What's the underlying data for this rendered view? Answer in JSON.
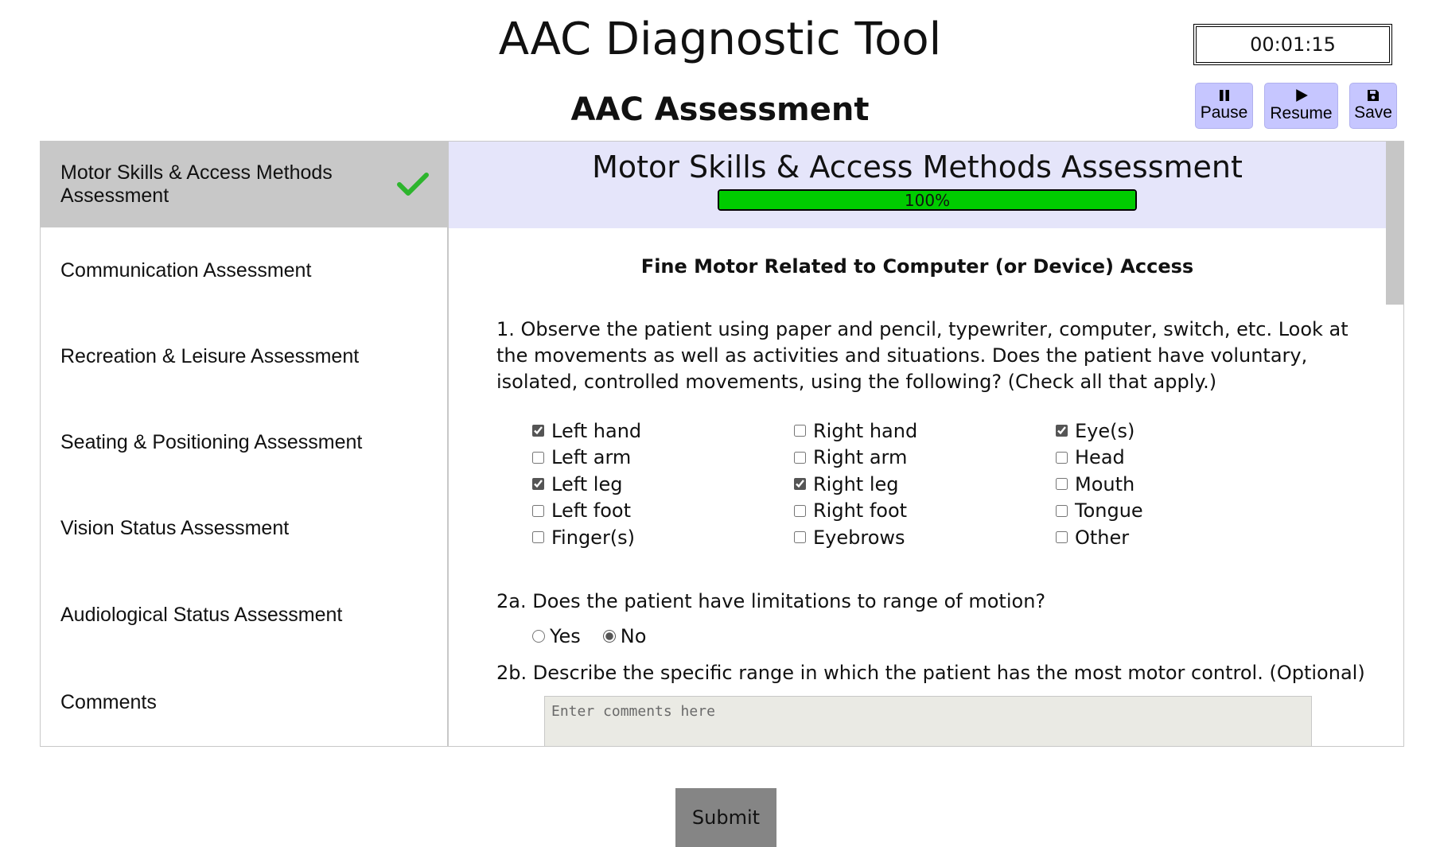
{
  "app": {
    "title": "AAC Diagnostic Tool",
    "subtitle": "AAC Assessment"
  },
  "timer": "00:01:15",
  "controls": {
    "pause": "Pause",
    "resume": "Resume",
    "save": "Save"
  },
  "sidebar": {
    "items": [
      {
        "label": "Motor Skills & Access Methods Assessment",
        "active": true,
        "completed": true
      },
      {
        "label": "Communication Assessment"
      },
      {
        "label": "Recreation & Leisure Assessment"
      },
      {
        "label": "Seating & Positioning Assessment"
      },
      {
        "label": "Vision Status Assessment"
      },
      {
        "label": "Audiological Status Assessment"
      },
      {
        "label": "Comments"
      }
    ]
  },
  "section": {
    "title": "Motor Skills & Access Methods Assessment",
    "progress_percent": 100,
    "progress_text": "100%",
    "heading": "Fine Motor Related to Computer (or Device) Access"
  },
  "q1": {
    "text": "1. Observe the patient using paper and pencil, typewriter, computer, switch, etc. Look at the movements as well as activities and situations. Does the patient have voluntary, isolated, controlled movements, using the following? (Check all that apply.)",
    "options": [
      {
        "label": "Left hand",
        "checked": true
      },
      {
        "label": "Left arm",
        "checked": false
      },
      {
        "label": "Left leg",
        "checked": true
      },
      {
        "label": "Left foot",
        "checked": false
      },
      {
        "label": "Finger(s)",
        "checked": false
      },
      {
        "label": "Right hand",
        "checked": false
      },
      {
        "label": "Right arm",
        "checked": false
      },
      {
        "label": "Right leg",
        "checked": true
      },
      {
        "label": "Right foot",
        "checked": false
      },
      {
        "label": "Eyebrows",
        "checked": false
      },
      {
        "label": "Eye(s)",
        "checked": true
      },
      {
        "label": "Head",
        "checked": false
      },
      {
        "label": "Mouth",
        "checked": false
      },
      {
        "label": "Tongue",
        "checked": false
      },
      {
        "label": "Other",
        "checked": false
      }
    ]
  },
  "q2a": {
    "text": "2a. Does the patient have limitations to range of motion?",
    "options": [
      {
        "label": "Yes",
        "checked": false
      },
      {
        "label": "No",
        "checked": true
      }
    ]
  },
  "q2b": {
    "text": "2b. Describe the specific range in which the patient has the most motor control. (Optional)",
    "placeholder": "Enter comments here",
    "value": ""
  },
  "submit_label": "Submit",
  "colors": {
    "accent_button": "#c6c6ff",
    "progress": "#00cc00",
    "check": "#2db52d",
    "header_bg": "#e5e5fa"
  }
}
